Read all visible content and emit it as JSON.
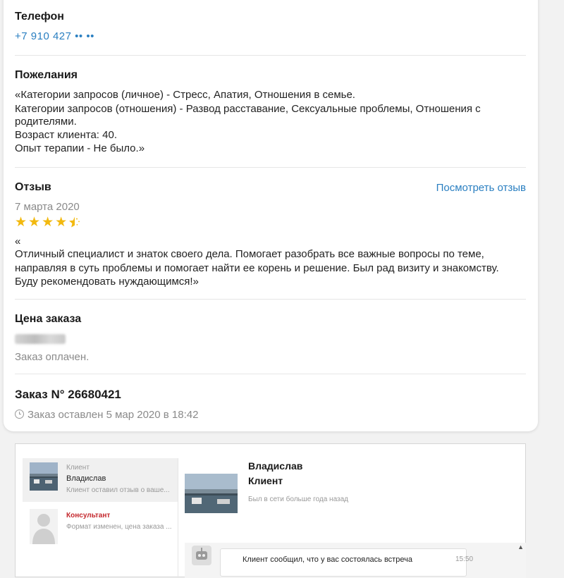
{
  "phone": {
    "heading": "Телефон",
    "value": "+7 910 427 •• ••"
  },
  "wishes": {
    "heading": "Пожелания",
    "lines": [
      "«Категории запросов (личное) - Стресс, Апатия, Отношения в семье.",
      "Категории запросов (отношения) - Развод расставание, Сексуальные проблемы, Отношения с",
      "родителями.",
      "Возраст клиента: 40.",
      "Опыт терапии - Не было.»"
    ]
  },
  "review": {
    "heading": "Отзыв",
    "view_link": "Посмотреть отзыв",
    "date": "7 марта 2020",
    "rating": 4.5,
    "star_color": "#f2b90f",
    "open_quote": "«",
    "lines": [
      "Отличный специалист и знаток своего дела. Помогает разобрать все важные вопросы по теме,",
      "направляя в суть проблемы и помогает найти ее корень и решение. Был рад визиту и знакомству.",
      "Буду рекомендовать нуждающимся!»"
    ]
  },
  "price": {
    "heading": "Цена заказа",
    "status": "Заказ оплачен."
  },
  "order": {
    "heading": "Заказ N° 26680421",
    "created": "Заказ оставлен 5 мар 2020 в 18:42"
  },
  "chat": {
    "items": [
      {
        "role": "Клиент",
        "name": "Владислав",
        "preview": "Клиент оставил отзыв о ваше..."
      },
      {
        "role": "Консультант",
        "name": "",
        "preview": "Формат изменен, цена заказа ..."
      }
    ],
    "profile": {
      "name": "Владислав",
      "role": "Клиент",
      "status": "Был в сети больше года назад"
    },
    "message": {
      "text": "Клиент сообщил, что у вас состоялась встреча",
      "time": "15:50"
    }
  },
  "colors": {
    "link": "#2a7fc1",
    "accent_red": "#c4282d"
  }
}
